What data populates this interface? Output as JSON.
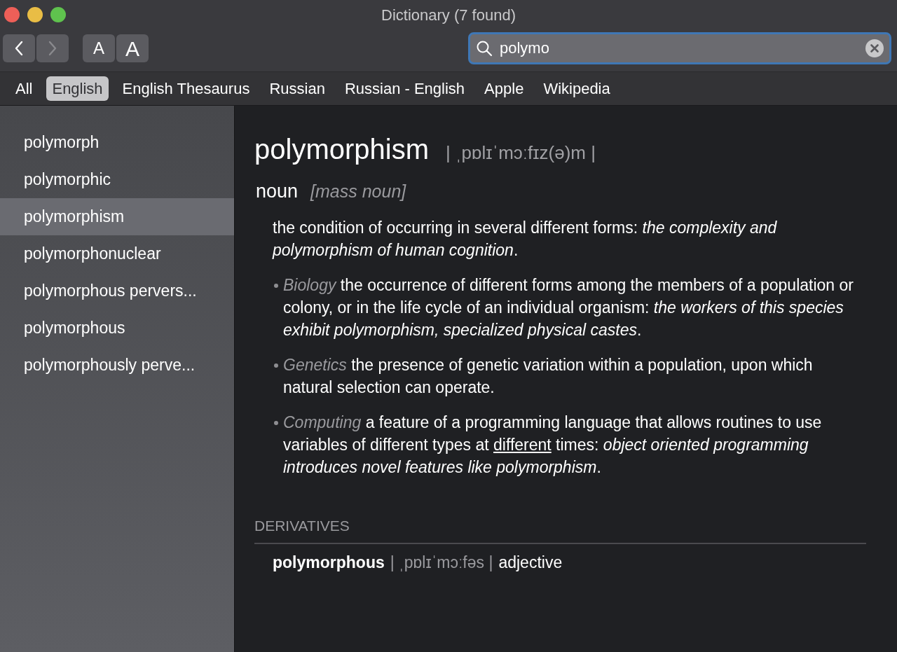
{
  "window": {
    "title": "Dictionary (7 found)"
  },
  "toolbar": {
    "font_buttons": [
      "A",
      "A"
    ]
  },
  "search": {
    "value": "polymo"
  },
  "tabs": [
    {
      "label": "All",
      "selected": false
    },
    {
      "label": "English",
      "selected": true
    },
    {
      "label": "English Thesaurus",
      "selected": false
    },
    {
      "label": "Russian",
      "selected": false
    },
    {
      "label": "Russian - English",
      "selected": false
    },
    {
      "label": "Apple",
      "selected": false
    },
    {
      "label": "Wikipedia",
      "selected": false
    }
  ],
  "sidebar": {
    "items": [
      {
        "label": "polymorph",
        "selected": false
      },
      {
        "label": "polymorphic",
        "selected": false
      },
      {
        "label": "polymorphism",
        "selected": true
      },
      {
        "label": "polymorphonuclear",
        "selected": false
      },
      {
        "label": "polymorphous pervers...",
        "selected": false
      },
      {
        "label": "polymorphous",
        "selected": false
      },
      {
        "label": "polymorphously perve...",
        "selected": false
      }
    ]
  },
  "entry": {
    "headword": "polymorphism",
    "pronunciation": "| ˌpɒlɪˈmɔːfɪz(ə)m |",
    "part_of_speech": "noun",
    "grammar": "[mass noun]",
    "main_sense": "the condition of occurring in several different forms: *the complexity and polymorphism of human cognition*.",
    "subsenses": [
      {
        "domain": "Biology",
        "text": "the occurrence of different forms among the members of a population or colony, or in the life cycle of an individual organism: *the workers of this species exhibit polymorphism, specialized physical castes*."
      },
      {
        "domain": "Genetics",
        "text": "the presence of genetic variation within a population, upon which natural selection can operate."
      },
      {
        "domain": "Computing",
        "text": "a feature of a programming language that allows routines to use variables of different types at ",
        "link": "different",
        "text_after": " times: *object oriented programming introduces novel features like polymorphism*."
      }
    ],
    "derivatives": {
      "heading": "DERIVATIVES",
      "items": [
        {
          "word": "polymorphous",
          "pronunciation": "| ˌpɒlɪˈmɔːfəs |",
          "part_of_speech": "adjective"
        }
      ]
    }
  }
}
